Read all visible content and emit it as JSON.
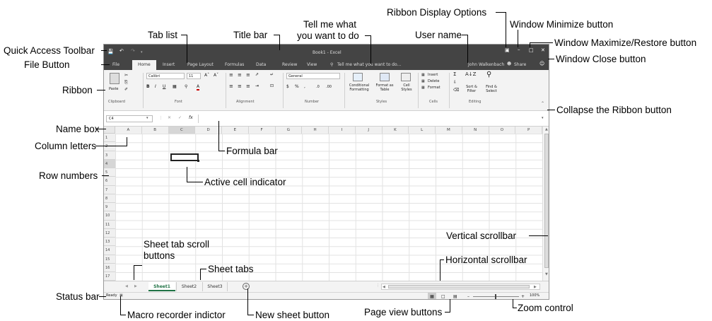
{
  "callouts": {
    "quick_access": "Quick Access Toolbar",
    "file_button": "File Button",
    "ribbon": "Ribbon",
    "name_box": "Name box",
    "column_letters": "Column letters",
    "row_numbers": "Row numbers",
    "status_bar": "Status bar",
    "tab_list": "Tab list",
    "title_bar": "Title bar",
    "tell_me_1": "Tell me what",
    "tell_me_2": "you want to do",
    "user_name": "User name",
    "ribbon_display": "Ribbon Display Options",
    "win_min": "Window Minimize button",
    "win_max": "Window Maximize/Restore button",
    "win_close": "Window Close button",
    "collapse_ribbon": "Collapse the Ribbon button",
    "formula_bar": "Formula bar",
    "active_cell": "Active cell indicator",
    "vertical_scrollbar": "Vertical scrollbar",
    "sheet_tab_scroll_1": "Sheet tab scroll",
    "sheet_tab_scroll_2": "buttons",
    "sheet_tabs": "Sheet tabs",
    "horizontal_scrollbar": "Horizontal scrollbar",
    "macro_recorder": "Macro recorder indictor",
    "new_sheet": "New sheet button",
    "page_view": "Page view buttons",
    "zoom_control": "Zoom control"
  },
  "excel": {
    "title": "Book1 - Excel",
    "tabs": [
      "File",
      "Home",
      "Insert",
      "Page Layout",
      "Formulas",
      "Data",
      "Review",
      "View"
    ],
    "tell_me_placeholder": "Tell me what you want to do...",
    "user_name": "John Walkenbach",
    "share_label": "Share",
    "ribbon": {
      "paste": "Paste",
      "font_name": "Calibri",
      "font_size": "11",
      "number_format": "General",
      "cond_format": "Conditional Formatting",
      "format_table": "Format as Table",
      "cell_styles": "Cell Styles",
      "insert": "Insert",
      "delete": "Delete",
      "format": "Format",
      "sort_filter": "Sort & Filter",
      "find_select": "Find & Select",
      "groups": [
        "Clipboard",
        "Font",
        "Alignment",
        "Number",
        "Styles",
        "Cells",
        "Editing"
      ]
    },
    "name_box_value": "C4",
    "fx": "fx",
    "columns": [
      "A",
      "B",
      "C",
      "D",
      "E",
      "F",
      "G",
      "H",
      "I",
      "J",
      "K",
      "L",
      "M",
      "N",
      "O",
      "P"
    ],
    "rows": [
      "1",
      "2",
      "3",
      "4",
      "5",
      "6",
      "7",
      "8",
      "9",
      "10",
      "11",
      "12",
      "13",
      "14",
      "15",
      "16",
      "17"
    ],
    "sheets": [
      "Sheet1",
      "Sheet2",
      "Sheet3"
    ],
    "status_text": "Ready",
    "zoom": "100%"
  }
}
